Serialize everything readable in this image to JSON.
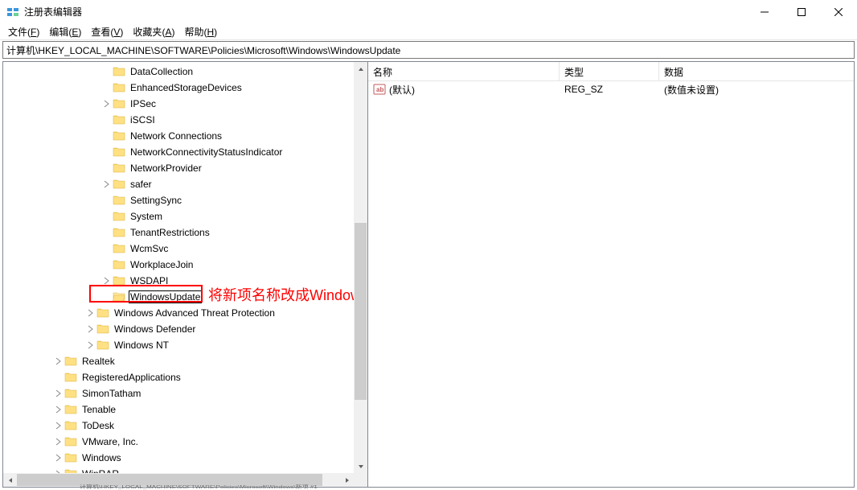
{
  "window": {
    "title": "注册表编辑器"
  },
  "menu": {
    "file": {
      "label": "文件",
      "accel": "F"
    },
    "edit": {
      "label": "编辑",
      "accel": "E"
    },
    "view": {
      "label": "查看",
      "accel": "V"
    },
    "fav": {
      "label": "收藏夹",
      "accel": "A"
    },
    "help": {
      "label": "帮助",
      "accel": "H"
    }
  },
  "addressBar": "计算机\\HKEY_LOCAL_MACHINE\\SOFTWARE\\Policies\\Microsoft\\Windows\\WindowsUpdate",
  "tree": [
    {
      "indent": 6,
      "exp": "",
      "label": "DataCollection"
    },
    {
      "indent": 6,
      "exp": "",
      "label": "EnhancedStorageDevices"
    },
    {
      "indent": 6,
      "exp": ">",
      "label": "IPSec"
    },
    {
      "indent": 6,
      "exp": "",
      "label": "iSCSI"
    },
    {
      "indent": 6,
      "exp": "",
      "label": "Network Connections"
    },
    {
      "indent": 6,
      "exp": "",
      "label": "NetworkConnectivityStatusIndicator"
    },
    {
      "indent": 6,
      "exp": "",
      "label": "NetworkProvider"
    },
    {
      "indent": 6,
      "exp": ">",
      "label": "safer"
    },
    {
      "indent": 6,
      "exp": "",
      "label": "SettingSync"
    },
    {
      "indent": 6,
      "exp": "",
      "label": "System"
    },
    {
      "indent": 6,
      "exp": "",
      "label": "TenantRestrictions"
    },
    {
      "indent": 6,
      "exp": "",
      "label": "WcmSvc"
    },
    {
      "indent": 6,
      "exp": "",
      "label": "WorkplaceJoin"
    },
    {
      "indent": 6,
      "exp": ">",
      "label": "WSDAPI"
    },
    {
      "indent": 6,
      "exp": "",
      "label": "WindowsUpdate",
      "editing": true
    },
    {
      "indent": 5,
      "exp": ">",
      "label": "Windows Advanced Threat Protection"
    },
    {
      "indent": 5,
      "exp": ">",
      "label": "Windows Defender"
    },
    {
      "indent": 5,
      "exp": ">",
      "label": "Windows NT"
    },
    {
      "indent": 3,
      "exp": ">",
      "label": "Realtek"
    },
    {
      "indent": 3,
      "exp": "",
      "label": "RegisteredApplications"
    },
    {
      "indent": 3,
      "exp": ">",
      "label": "SimonTatham"
    },
    {
      "indent": 3,
      "exp": ">",
      "label": "Tenable"
    },
    {
      "indent": 3,
      "exp": ">",
      "label": "ToDesk"
    },
    {
      "indent": 3,
      "exp": ">",
      "label": "VMware, Inc."
    },
    {
      "indent": 3,
      "exp": ">",
      "label": "Windows"
    },
    {
      "indent": 3,
      "exp": ">",
      "label": "WinRAR"
    }
  ],
  "annotation": "将新项名称改成WindowsUpdate",
  "list": {
    "headers": {
      "name": "名称",
      "type": "类型",
      "data": "数据"
    },
    "rows": [
      {
        "name": "(默认)",
        "type": "REG_SZ",
        "data": "(数值未设置)"
      }
    ]
  },
  "footer": "计算机\\HKEY_LOCAL_MACHINE\\SOFTWARE\\Policies\\Microsoft\\Windows\\新项 #1"
}
